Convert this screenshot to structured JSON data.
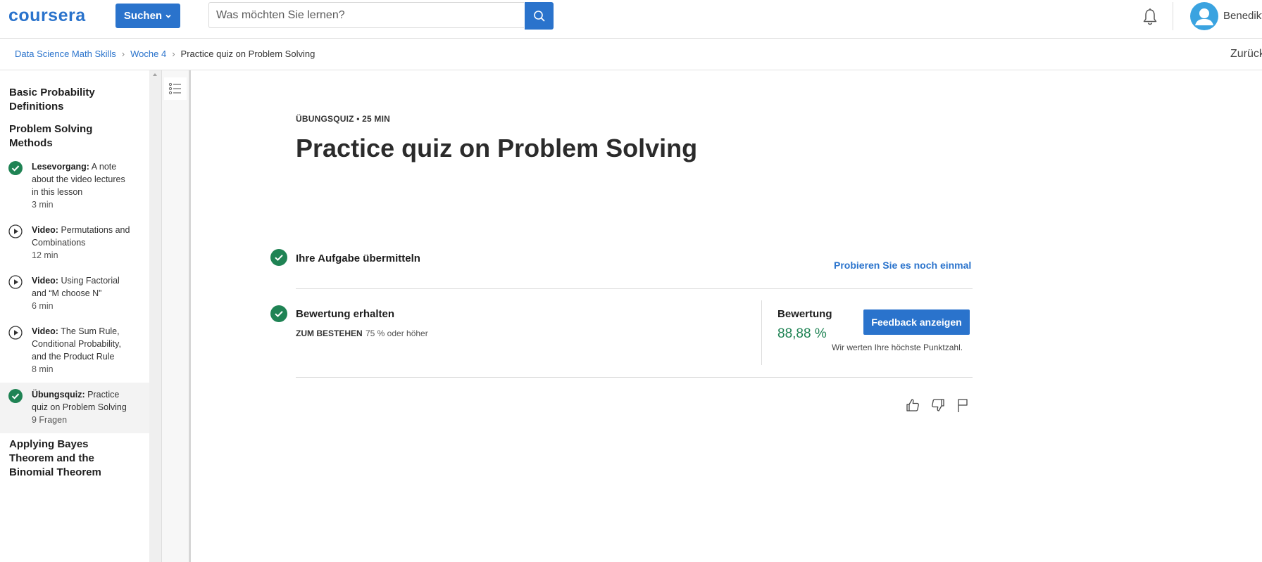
{
  "header": {
    "logo": "coursera",
    "search_button_label": "Suchen",
    "search_placeholder": "Was möchten Sie lernen?",
    "user_name": "Benedikt"
  },
  "breadcrumb": {
    "items": [
      "Data Science Math Skills",
      "Woche 4",
      "Practice quiz on Problem Solving"
    ],
    "back_label": "Zurück"
  },
  "sidebar": {
    "sections": [
      "Basic Probability Definitions",
      "Problem Solving Methods",
      "Applying Bayes Theorem and the Binomial Theorem"
    ],
    "items": [
      {
        "type": "Lesevorgang:",
        "title": "A note about the video lectures in this lesson",
        "duration": "3 min",
        "status": "completed"
      },
      {
        "type": "Video:",
        "title": "Permutations and Combinations",
        "duration": "12 min",
        "status": "not-started"
      },
      {
        "type": "Video:",
        "title": "Using Factorial and “M choose N”",
        "duration": "6 min",
        "status": "not-started"
      },
      {
        "type": "Video:",
        "title": "The Sum Rule, Conditional Probability, and the Product Rule",
        "duration": "8 min",
        "status": "not-started"
      },
      {
        "type": "Übungsquiz:",
        "title": "Practice quiz on Problem Solving",
        "duration": "9 Fragen",
        "status": "completed"
      }
    ]
  },
  "main": {
    "kicker": "ÜBUNGSQUIZ • 25 MIN",
    "title": "Practice quiz on Problem Solving",
    "step1_title": "Ihre Aufgabe übermitteln",
    "retry_label": "Probieren Sie es noch einmal",
    "step2_title": "Bewertung erhalten",
    "pass_label": "ZUM BESTEHEN",
    "pass_value": "75 % oder höher",
    "grade_label": "Bewertung",
    "grade_value": "88,88 %",
    "feedback_button": "Feedback anzeigen",
    "note": "Wir werten Ihre höchste Punktzahl."
  },
  "colors": {
    "brand_blue": "#2a73cc",
    "success_green": "#1f8354"
  }
}
